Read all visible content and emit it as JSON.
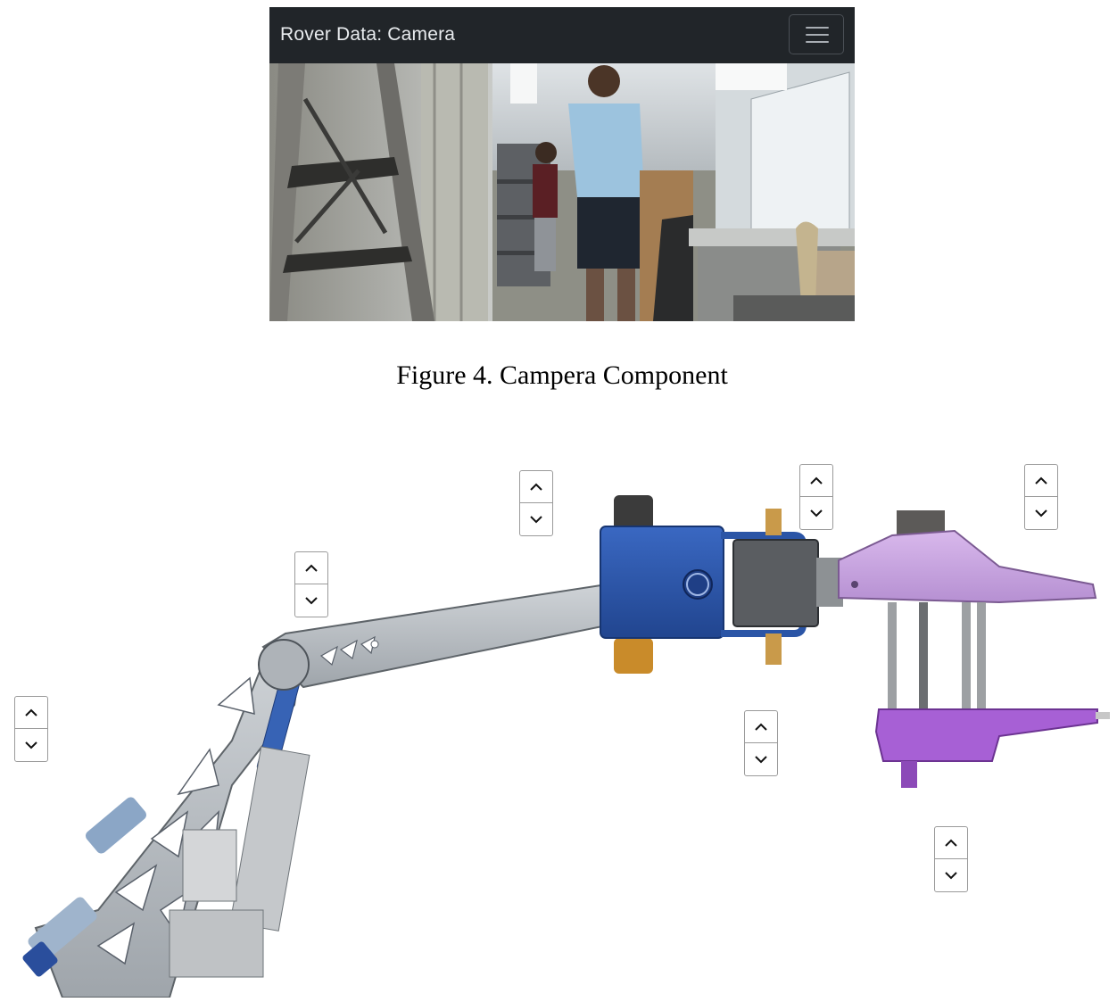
{
  "camera": {
    "title": "Rover Data: Camera",
    "menu_icon": "hamburger-menu-icon"
  },
  "caption": "Figure 4. Campera Component",
  "arm_controls": {
    "up_icon": "chevron-up-icon",
    "down_icon": "chevron-down-icon",
    "joints": [
      {
        "id": "base"
      },
      {
        "id": "shoulder"
      },
      {
        "id": "elbow"
      },
      {
        "id": "wrist-pitch"
      },
      {
        "id": "wrist-roll"
      },
      {
        "id": "gripper"
      },
      {
        "id": "end-effector-lower"
      }
    ]
  },
  "colors": {
    "navbar_bg": "#212529",
    "arm_grey": "#b9bdc2",
    "wrist_blue": "#2f5bb0",
    "gripper_purple": "#c9a3e0",
    "gripper_dark_purple": "#a45bd1"
  }
}
